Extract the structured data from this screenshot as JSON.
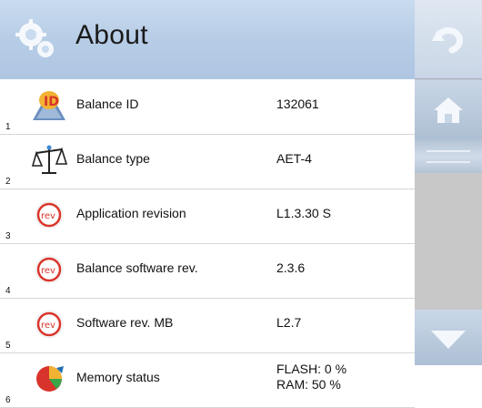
{
  "header": {
    "title": "About",
    "icon": "gears-icon"
  },
  "rows": [
    {
      "num": "1",
      "icon": "balance-id-icon",
      "label": "Balance ID",
      "value": "132061"
    },
    {
      "num": "2",
      "icon": "balance-type-icon",
      "label": "Balance type",
      "value": "AET-4"
    },
    {
      "num": "3",
      "icon": "rev-icon",
      "label": "Application revision",
      "value": "L1.3.30 S"
    },
    {
      "num": "4",
      "icon": "rev-icon",
      "label": "Balance software rev.",
      "value": "2.3.6"
    },
    {
      "num": "5",
      "icon": "rev-icon",
      "label": "Software rev. MB",
      "value": "L2.7"
    },
    {
      "num": "6",
      "icon": "memory-status-icon",
      "label": "Memory status",
      "value_lines": [
        "FLASH: 0 %",
        "RAM: 50 %"
      ]
    }
  ],
  "sidebar": {
    "back": "undo-icon",
    "home": "home-icon",
    "scroll": "scroll-handle",
    "down": "arrow-down-icon"
  },
  "colors": {
    "header_bg": "#b7cde6",
    "sidebar_bg": "#c6c6c6",
    "rev_red": "#d9342b",
    "accent_blue": "#1f6fb0"
  }
}
